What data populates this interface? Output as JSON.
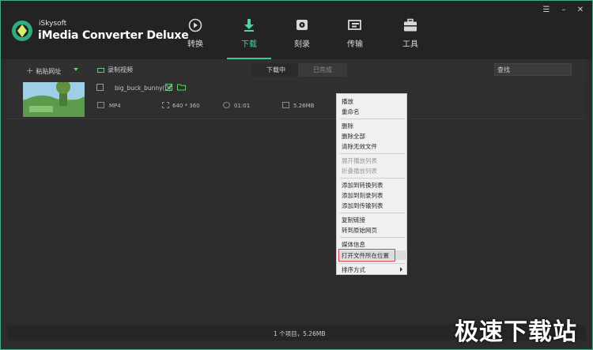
{
  "app": {
    "brand_small": "iSkysoft",
    "brand_big": "iMedia Converter Deluxe"
  },
  "nav": {
    "tabs": [
      {
        "label": "转换",
        "icon": "convert-icon"
      },
      {
        "label": "下载",
        "icon": "download-icon",
        "active": true
      },
      {
        "label": "刻录",
        "icon": "burn-icon"
      },
      {
        "label": "传输",
        "icon": "transfer-icon"
      },
      {
        "label": "工具",
        "icon": "toolbox-icon"
      }
    ]
  },
  "window_controls": {
    "menu": "☰",
    "minimize": "–",
    "close": "✕"
  },
  "toolbar": {
    "paste_label": "粘贴网址",
    "record_label": "录制视频",
    "tab_downloading": "下载中",
    "tab_done": "已完成",
    "search_value": "查找"
  },
  "file": {
    "name": "big_buck_bunny(0)",
    "format": "MP4",
    "resolution": "640 * 360",
    "duration": "01:01",
    "size": "5.26MB"
  },
  "context_menu": {
    "items": [
      {
        "label": "播放"
      },
      {
        "label": "重命名"
      },
      {
        "label": "删除"
      },
      {
        "label": "删除全部"
      },
      {
        "label": "清除无效文件"
      },
      {
        "label": "展开播放列表",
        "disabled": true
      },
      {
        "label": "折叠播放列表",
        "disabled": true
      },
      {
        "label": "添加到转换列表"
      },
      {
        "label": "添加到刻录列表"
      },
      {
        "label": "添加到传输列表"
      },
      {
        "label": "复制链接"
      },
      {
        "label": "转到原始网页"
      },
      {
        "label": "媒体信息"
      },
      {
        "label": "打开文件所在位置",
        "highlighted": true
      },
      {
        "label": "排序方式"
      }
    ]
  },
  "status": {
    "text": "1 个项目，5.26MB"
  },
  "watermark": "极速下载站",
  "colors": {
    "accent": "#3fc79a",
    "highlight_box": "#e23b3b"
  }
}
